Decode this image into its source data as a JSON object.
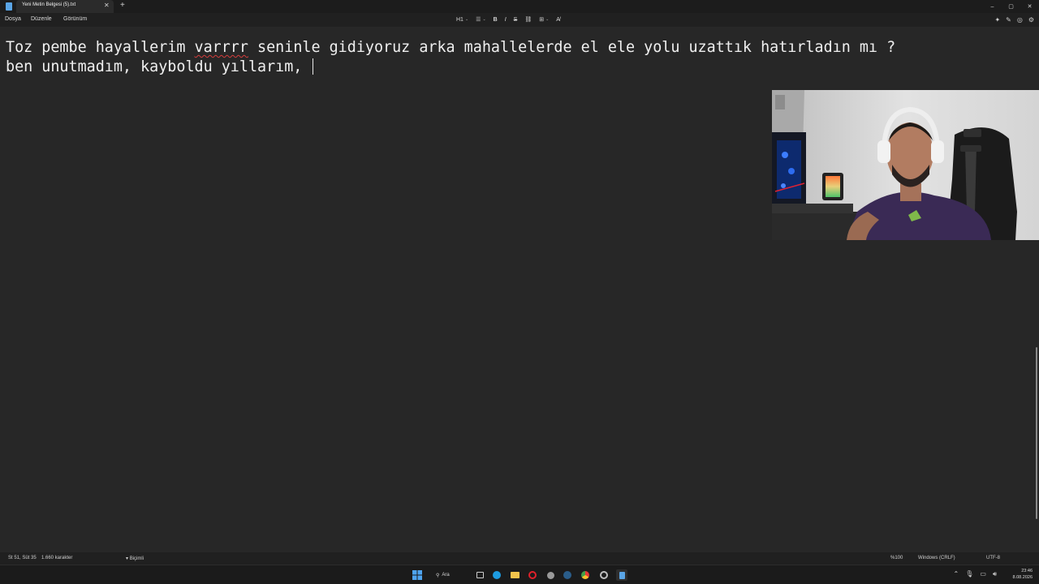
{
  "tab": {
    "title": "Yeni Metin Belgesi (5).txt",
    "close_icon": "✕",
    "new_tab_icon": "+"
  },
  "window_controls": {
    "minimize": "–",
    "maximize": "▢",
    "close": "✕"
  },
  "menu": {
    "file": "Dosya",
    "edit": "Düzenle",
    "view": "Görünüm"
  },
  "toolbar": {
    "heading": "H1",
    "list_icon": "☰",
    "bold": "B",
    "italic": "I",
    "strike": "S",
    "link_icon": "⛓",
    "table_icon": "⊞",
    "clear_format_icon": "A̸",
    "caret": "⌄"
  },
  "right_tools": {
    "copilot_icon": "✦",
    "chat_icon": "✎",
    "assist_icon": "◎",
    "settings_icon": "⚙"
  },
  "editor": {
    "line1_before": "Toz pembe hayallerim ",
    "line1_misspelled": "varrrr",
    "line1_after": " seninle gidiyoruz arka mahallelerde el ele yolu uzattık hatırladın mı ?",
    "line2": "ben unutmadım, kayboldu yıllarım, "
  },
  "status": {
    "position": "St 51, Süt 35",
    "characters": "1.660 karakter",
    "format": "Biçimli",
    "zoom": "%100",
    "line_ending": "Windows (CRLF)",
    "encoding": "UTF-8"
  },
  "taskbar": {
    "search_label": "Ara",
    "clock_time": "23:46",
    "clock_date": "8.08.2026"
  },
  "colors": {
    "accent": "#5aa5e6",
    "misspelled_underline": "#d43c3c",
    "editor_bg": "#272727"
  }
}
